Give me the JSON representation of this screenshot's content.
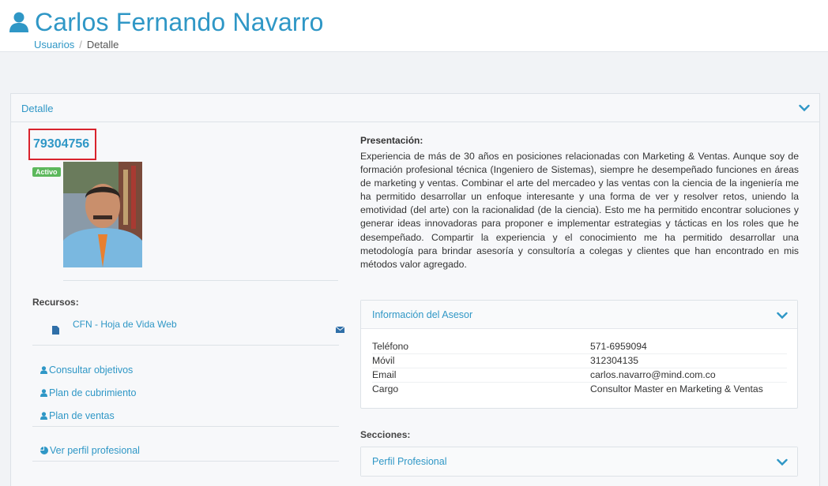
{
  "header": {
    "title": "Carlos Fernando Navarro",
    "breadcrumb": {
      "parent": "Usuarios",
      "separator": "/",
      "current": "Detalle"
    }
  },
  "panel": {
    "title": "Detalle",
    "user_id": "79304756",
    "status_badge": "Activo",
    "resources_label": "Recursos:",
    "resource_link": "CFN - Hoja de Vida Web",
    "links": {
      "objectives": "Consultar objetivos",
      "coverage": "Plan de cubrimiento",
      "sales": "Plan de ventas",
      "profile": "Ver perfil profesional"
    },
    "presentation_label": "Presentación:",
    "presentation_text": "Experiencia de más de 30 años en posiciones relacionadas con Marketing & Ventas. Aunque soy de formación profesional técnica (Ingeniero de Sistemas), siempre he desempeñado funciones en áreas de marketing y ventas. Combinar el arte del mercadeo y las ventas con la ciencia de la ingeniería me ha permitido desarrollar un enfoque interesante y una forma de ver y resolver retos, uniendo la emotividad (del arte) con la racionalidad (de la ciencia). Esto me ha permitido encontrar soluciones y generar ideas innovadoras para proponer e implementar estrategias y tácticas en los roles que he desempeñado. Compartir la experiencia y el conocimiento me ha permitido desarrollar una metodología para brindar asesoría y consultoría a colegas y clientes que han encontrado en mis métodos valor agregado.",
    "advisor_panel": {
      "title": "Información del Asesor",
      "rows": [
        {
          "key": "Teléfono",
          "value": "571-6959094"
        },
        {
          "key": "Móvil",
          "value": "312304135"
        },
        {
          "key": "Email",
          "value": "carlos.navarro@mind.com.co"
        },
        {
          "key": "Cargo",
          "value": "Consultor Master en Marketing & Ventas"
        }
      ]
    },
    "sections_label": "Secciones:",
    "profile_panel_title": "Perfil Profesional"
  },
  "colors": {
    "accent": "#2f97c6",
    "badge": "#5cb85c",
    "highlight": "#d9232d"
  }
}
